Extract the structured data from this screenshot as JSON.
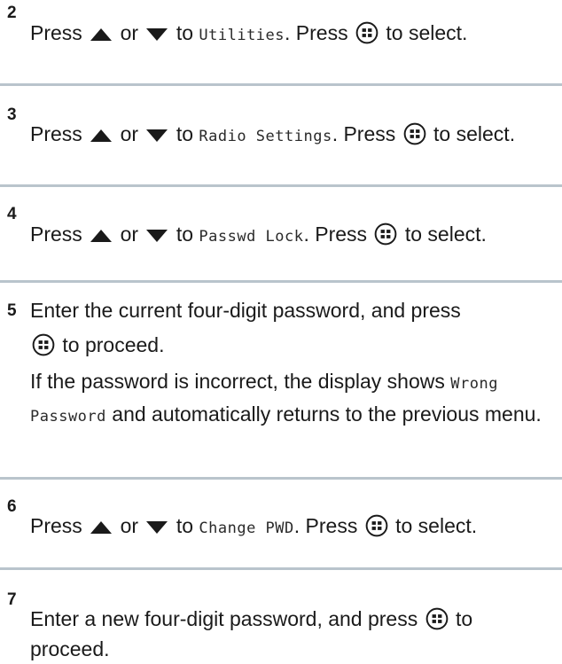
{
  "steps": [
    {
      "number": "2",
      "segments": {
        "press": "Press",
        "or": "or",
        "to": "to",
        "menu": "Utilities",
        "press_after": ". Press",
        "end": "to select."
      }
    },
    {
      "number": "3",
      "segments": {
        "press": "Press",
        "or": "or",
        "to": "to",
        "menu": "Radio Settings",
        "press_after": ". Press",
        "end": "to select."
      }
    },
    {
      "number": "4",
      "segments": {
        "press": "Press",
        "or": "or",
        "to": "to",
        "menu": "Passwd Lock",
        "press_after": ". Press",
        "end": "to select."
      }
    },
    {
      "number": "5",
      "line1": "Enter the current four-digit password, and press",
      "line2": "to proceed.",
      "note_before": "If the password is incorrect, the display shows",
      "note_menu": "Wrong Password",
      "note_after": "and automatically returns to the previous menu."
    },
    {
      "number": "6",
      "segments": {
        "press": "Press",
        "or": "or",
        "to": "to",
        "menu": "Change PWD",
        "press_after": ". Press",
        "end": "to select."
      }
    },
    {
      "number": "7",
      "text": "Enter a new four-digit password, and press",
      "end": "to proceed."
    }
  ],
  "icons": {
    "up": "up-arrow-icon",
    "down": "down-arrow-icon",
    "menu": "menu-ok-button-icon"
  }
}
